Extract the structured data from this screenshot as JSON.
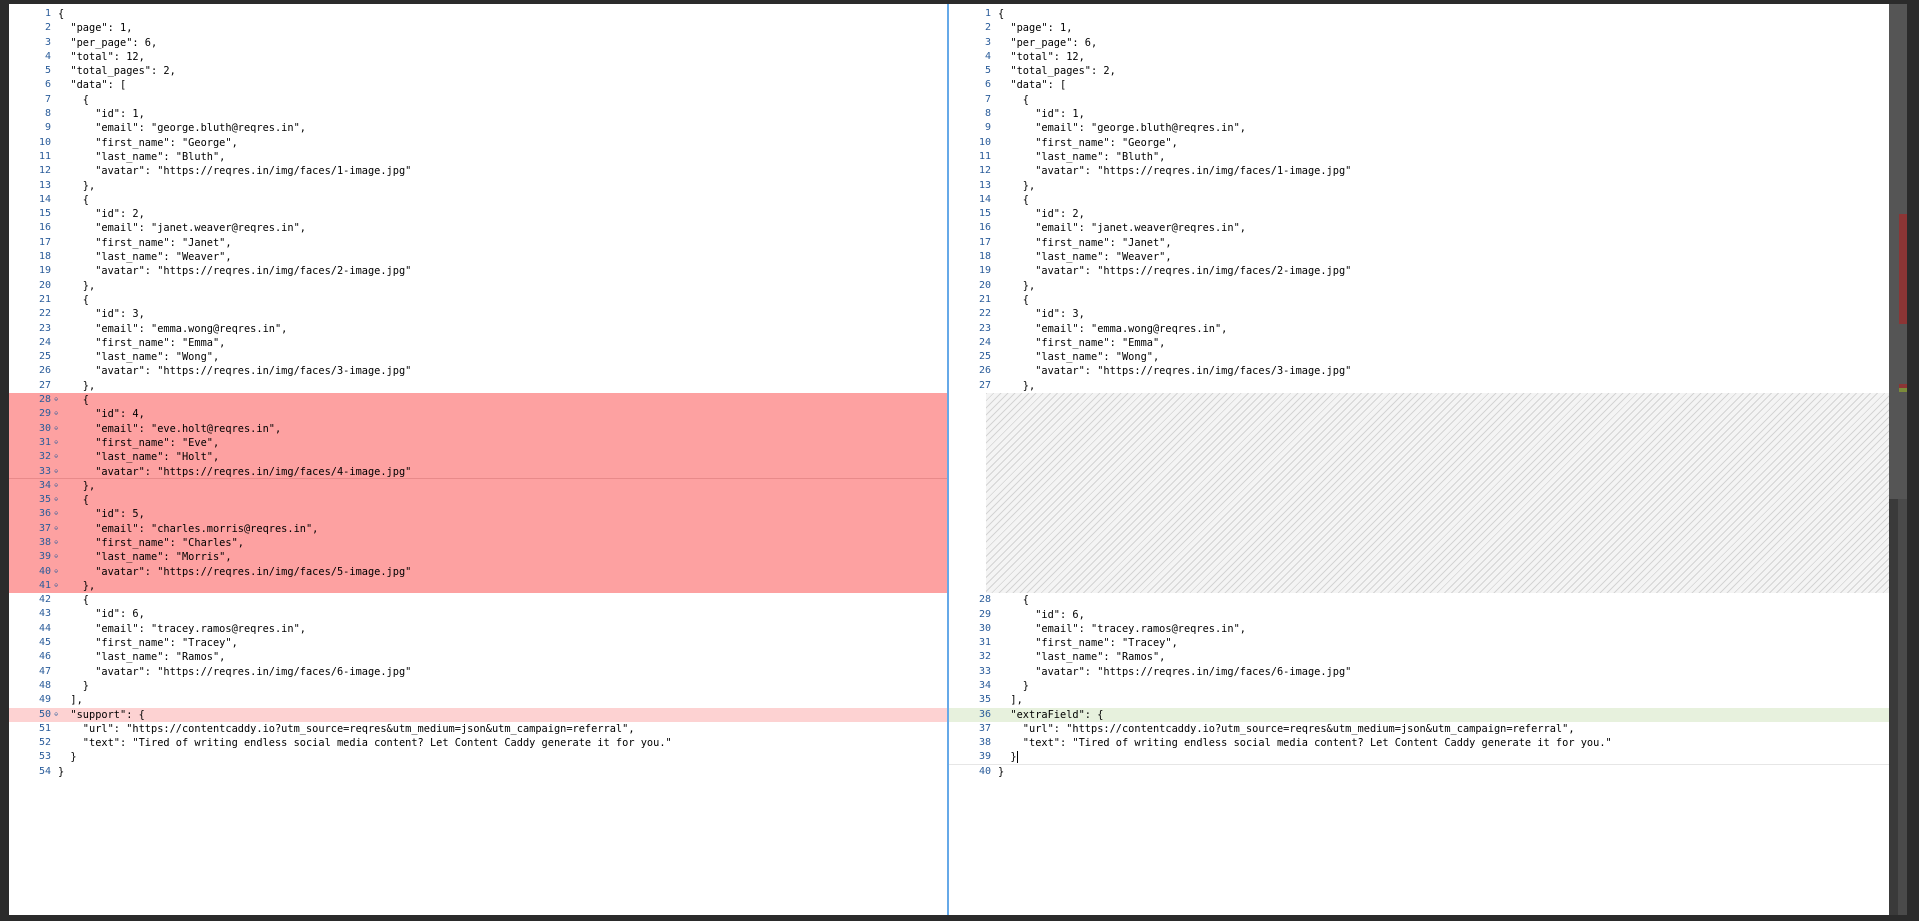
{
  "left": {
    "lines": [
      {
        "n": "1",
        "t": "{",
        "k": ""
      },
      {
        "n": "2",
        "t": "  \"page\": 1,",
        "k": ""
      },
      {
        "n": "3",
        "t": "  \"per_page\": 6,",
        "k": ""
      },
      {
        "n": "4",
        "t": "  \"total\": 12,",
        "k": ""
      },
      {
        "n": "5",
        "t": "  \"total_pages\": 2,",
        "k": ""
      },
      {
        "n": "6",
        "t": "  \"data\": [",
        "k": ""
      },
      {
        "n": "7",
        "t": "    {",
        "k": ""
      },
      {
        "n": "8",
        "t": "      \"id\": 1,",
        "k": ""
      },
      {
        "n": "9",
        "t": "      \"email\": \"george.bluth@reqres.in\",",
        "k": ""
      },
      {
        "n": "10",
        "t": "      \"first_name\": \"George\",",
        "k": ""
      },
      {
        "n": "11",
        "t": "      \"last_name\": \"Bluth\",",
        "k": ""
      },
      {
        "n": "12",
        "t": "      \"avatar\": \"https://reqres.in/img/faces/1-image.jpg\"",
        "k": ""
      },
      {
        "n": "13",
        "t": "    },",
        "k": ""
      },
      {
        "n": "14",
        "t": "    {",
        "k": ""
      },
      {
        "n": "15",
        "t": "      \"id\": 2,",
        "k": ""
      },
      {
        "n": "16",
        "t": "      \"email\": \"janet.weaver@reqres.in\",",
        "k": ""
      },
      {
        "n": "17",
        "t": "      \"first_name\": \"Janet\",",
        "k": ""
      },
      {
        "n": "18",
        "t": "      \"last_name\": \"Weaver\",",
        "k": ""
      },
      {
        "n": "19",
        "t": "      \"avatar\": \"https://reqres.in/img/faces/2-image.jpg\"",
        "k": ""
      },
      {
        "n": "20",
        "t": "    },",
        "k": ""
      },
      {
        "n": "21",
        "t": "    {",
        "k": ""
      },
      {
        "n": "22",
        "t": "      \"id\": 3,",
        "k": ""
      },
      {
        "n": "23",
        "t": "      \"email\": \"emma.wong@reqres.in\",",
        "k": ""
      },
      {
        "n": "24",
        "t": "      \"first_name\": \"Emma\",",
        "k": ""
      },
      {
        "n": "25",
        "t": "      \"last_name\": \"Wong\",",
        "k": ""
      },
      {
        "n": "26",
        "t": "      \"avatar\": \"https://reqres.in/img/faces/3-image.jpg\"",
        "k": ""
      },
      {
        "n": "27",
        "t": "    },",
        "k": ""
      },
      {
        "n": "28",
        "t": "    {",
        "k": "del"
      },
      {
        "n": "29",
        "t": "      \"id\": 4,",
        "k": "del"
      },
      {
        "n": "30",
        "t": "      \"email\": \"eve.holt@reqres.in\",",
        "k": "del"
      },
      {
        "n": "31",
        "t": "      \"first_name\": \"Eve\",",
        "k": "del"
      },
      {
        "n": "32",
        "t": "      \"last_name\": \"Holt\",",
        "k": "del"
      },
      {
        "n": "33",
        "t": "      \"avatar\": \"https://reqres.in/img/faces/4-image.jpg\"",
        "k": "del sep"
      },
      {
        "n": "34",
        "t": "    },",
        "k": "del"
      },
      {
        "n": "35",
        "t": "    {",
        "k": "del"
      },
      {
        "n": "36",
        "t": "      \"id\": 5,",
        "k": "del"
      },
      {
        "n": "37",
        "t": "      \"email\": \"charles.morris@reqres.in\",",
        "k": "del"
      },
      {
        "n": "38",
        "t": "      \"first_name\": \"Charles\",",
        "k": "del"
      },
      {
        "n": "39",
        "t": "      \"last_name\": \"Morris\",",
        "k": "del"
      },
      {
        "n": "40",
        "t": "      \"avatar\": \"https://reqres.in/img/faces/5-image.jpg\"",
        "k": "del"
      },
      {
        "n": "41",
        "t": "    },",
        "k": "del"
      },
      {
        "n": "42",
        "t": "    {",
        "k": ""
      },
      {
        "n": "43",
        "t": "      \"id\": 6,",
        "k": ""
      },
      {
        "n": "44",
        "t": "      \"email\": \"tracey.ramos@reqres.in\",",
        "k": ""
      },
      {
        "n": "45",
        "t": "      \"first_name\": \"Tracey\",",
        "k": ""
      },
      {
        "n": "46",
        "t": "      \"last_name\": \"Ramos\",",
        "k": ""
      },
      {
        "n": "47",
        "t": "      \"avatar\": \"https://reqres.in/img/faces/6-image.jpg\"",
        "k": ""
      },
      {
        "n": "48",
        "t": "    }",
        "k": ""
      },
      {
        "n": "49",
        "t": "  ],",
        "k": ""
      },
      {
        "n": "50",
        "t": "  \"support\": {",
        "k": "del-light"
      },
      {
        "n": "51",
        "t": "    \"url\": \"https://contentcaddy.io?utm_source=reqres&utm_medium=json&utm_campaign=referral\",",
        "k": ""
      },
      {
        "n": "52",
        "t": "    \"text\": \"Tired of writing endless social media content? Let Content Caddy generate it for you.\"",
        "k": ""
      },
      {
        "n": "53",
        "t": "  }",
        "k": ""
      },
      {
        "n": "54",
        "t": "}",
        "k": ""
      }
    ]
  },
  "right": {
    "lines_before": [
      {
        "n": "1",
        "t": "{",
        "k": ""
      },
      {
        "n": "2",
        "t": "  \"page\": 1,",
        "k": ""
      },
      {
        "n": "3",
        "t": "  \"per_page\": 6,",
        "k": ""
      },
      {
        "n": "4",
        "t": "  \"total\": 12,",
        "k": ""
      },
      {
        "n": "5",
        "t": "  \"total_pages\": 2,",
        "k": ""
      },
      {
        "n": "6",
        "t": "  \"data\": [",
        "k": ""
      },
      {
        "n": "7",
        "t": "    {",
        "k": ""
      },
      {
        "n": "8",
        "t": "      \"id\": 1,",
        "k": ""
      },
      {
        "n": "9",
        "t": "      \"email\": \"george.bluth@reqres.in\",",
        "k": ""
      },
      {
        "n": "10",
        "t": "      \"first_name\": \"George\",",
        "k": ""
      },
      {
        "n": "11",
        "t": "      \"last_name\": \"Bluth\",",
        "k": ""
      },
      {
        "n": "12",
        "t": "      \"avatar\": \"https://reqres.in/img/faces/1-image.jpg\"",
        "k": ""
      },
      {
        "n": "13",
        "t": "    },",
        "k": ""
      },
      {
        "n": "14",
        "t": "    {",
        "k": ""
      },
      {
        "n": "15",
        "t": "      \"id\": 2,",
        "k": ""
      },
      {
        "n": "16",
        "t": "      \"email\": \"janet.weaver@reqres.in\",",
        "k": ""
      },
      {
        "n": "17",
        "t": "      \"first_name\": \"Janet\",",
        "k": ""
      },
      {
        "n": "18",
        "t": "      \"last_name\": \"Weaver\",",
        "k": ""
      },
      {
        "n": "19",
        "t": "      \"avatar\": \"https://reqres.in/img/faces/2-image.jpg\"",
        "k": ""
      },
      {
        "n": "20",
        "t": "    },",
        "k": ""
      },
      {
        "n": "21",
        "t": "    {",
        "k": ""
      },
      {
        "n": "22",
        "t": "      \"id\": 3,",
        "k": ""
      },
      {
        "n": "23",
        "t": "      \"email\": \"emma.wong@reqres.in\",",
        "k": ""
      },
      {
        "n": "24",
        "t": "      \"first_name\": \"Emma\",",
        "k": ""
      },
      {
        "n": "25",
        "t": "      \"last_name\": \"Wong\",",
        "k": ""
      },
      {
        "n": "26",
        "t": "      \"avatar\": \"https://reqres.in/img/faces/3-image.jpg\"",
        "k": ""
      },
      {
        "n": "27",
        "t": "    },",
        "k": ""
      }
    ],
    "lines_after": [
      {
        "n": "28",
        "t": "    {",
        "k": ""
      },
      {
        "n": "29",
        "t": "      \"id\": 6,",
        "k": ""
      },
      {
        "n": "30",
        "t": "      \"email\": \"tracey.ramos@reqres.in\",",
        "k": ""
      },
      {
        "n": "31",
        "t": "      \"first_name\": \"Tracey\",",
        "k": ""
      },
      {
        "n": "32",
        "t": "      \"last_name\": \"Ramos\",",
        "k": ""
      },
      {
        "n": "33",
        "t": "      \"avatar\": \"https://reqres.in/img/faces/6-image.jpg\"",
        "k": ""
      },
      {
        "n": "34",
        "t": "    }",
        "k": ""
      },
      {
        "n": "35",
        "t": "  ],",
        "k": ""
      },
      {
        "n": "36",
        "t": "  \"extraField\": {",
        "k": "add-light"
      },
      {
        "n": "37",
        "t": "    \"url\": \"https://contentcaddy.io?utm_source=reqres&utm_medium=json&utm_campaign=referral\",",
        "k": ""
      },
      {
        "n": "38",
        "t": "    \"text\": \"Tired of writing endless social media content? Let Content Caddy generate it for you.\"",
        "k": ""
      },
      {
        "n": "39",
        "t": "  }",
        "k": "sep caret"
      },
      {
        "n": "40",
        "t": "}",
        "k": ""
      }
    ]
  },
  "colors": {
    "deleted_line": "#fda1a1",
    "changed_line_left": "#fdd2d2",
    "changed_line_right": "#e7f1dd",
    "line_number": "#2a5c9a",
    "divider": "#66a9e8"
  }
}
